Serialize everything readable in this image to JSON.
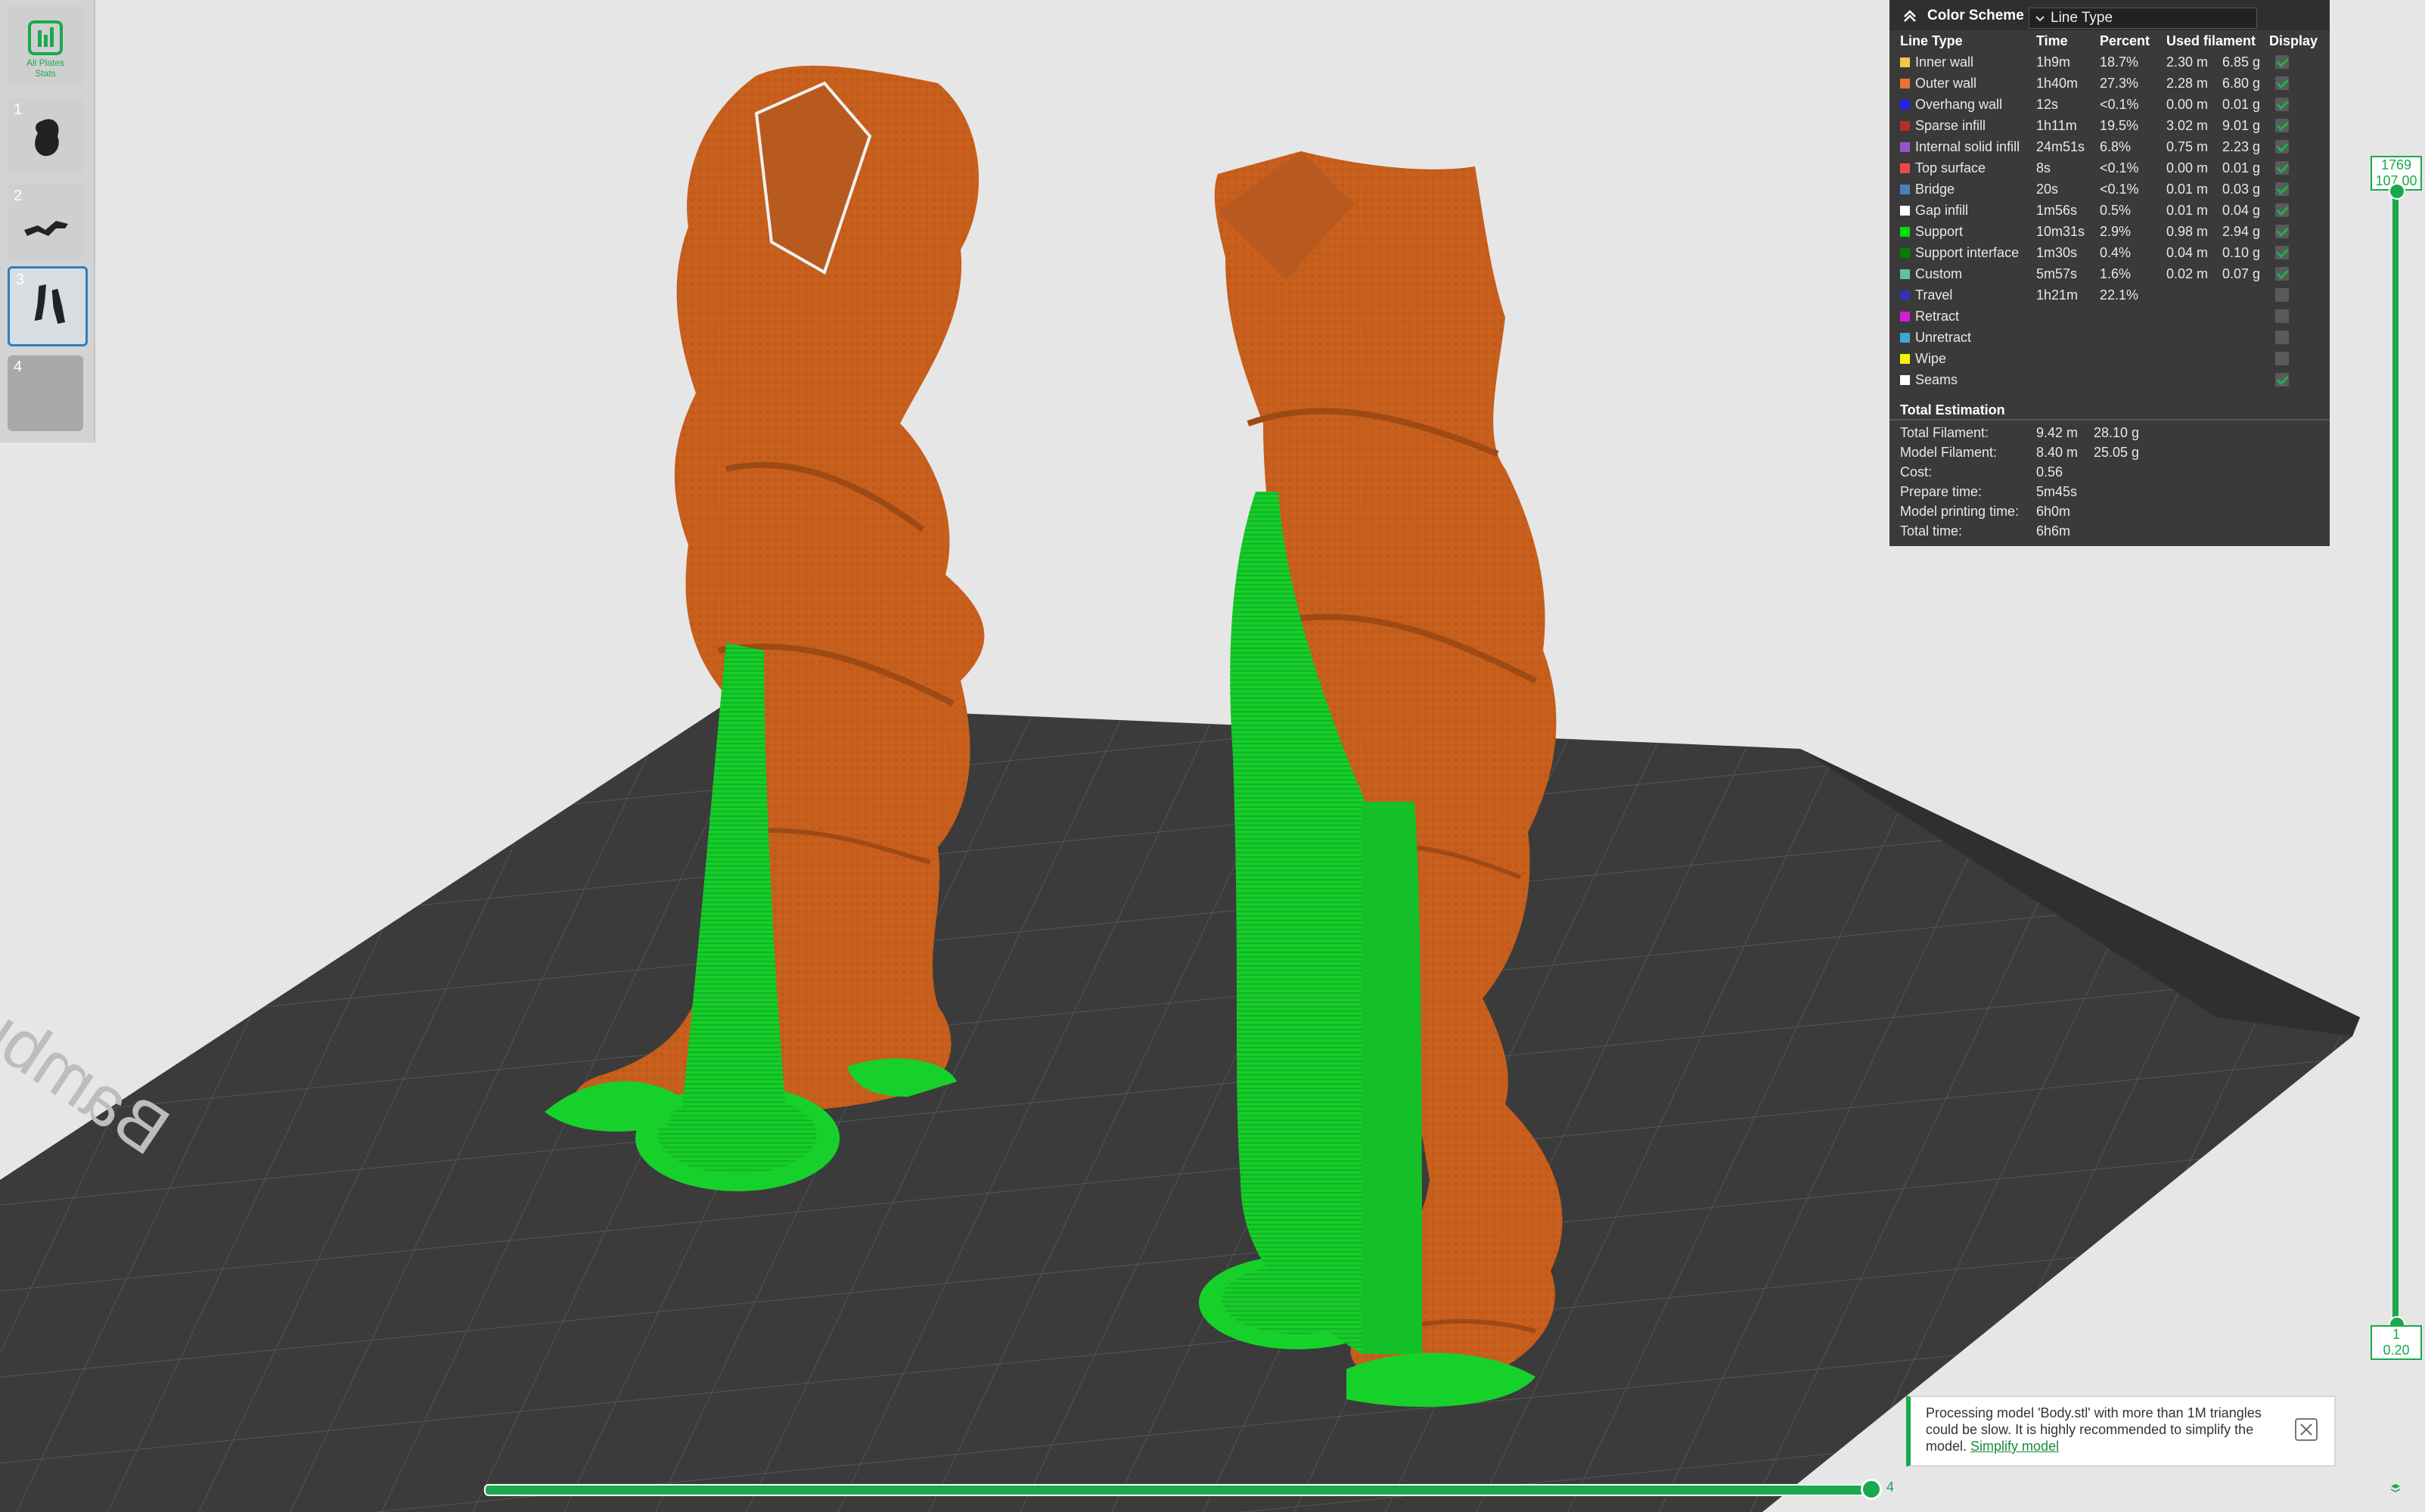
{
  "app": {
    "window": "3D slice preview"
  },
  "colors": {
    "accent": "#1aa94c",
    "model_orange": "#c8601c",
    "support_green": "#17d12b",
    "bed_dark": "#3b3b3b",
    "background": "#e6e6e6"
  },
  "plate_bar": {
    "stats_label_line1": "All Plates",
    "stats_label_line2": "Stats",
    "plates": [
      {
        "number": "1"
      },
      {
        "number": "2"
      },
      {
        "number": "3"
      },
      {
        "number": "4"
      }
    ],
    "selected_plate": "3"
  },
  "bed": {
    "label": "Bambu Textured PEI Plate"
  },
  "legend": {
    "title": "Color Scheme",
    "scheme_value": "Line Type",
    "columns": [
      "Line Type",
      "Time",
      "Percent",
      "Used filament",
      "Display"
    ],
    "rows": [
      {
        "name": "Inner wall",
        "color": "#f2c744",
        "time": "1h9m",
        "percent": "18.7%",
        "length": "2.30 m",
        "weight": "6.85 g",
        "display": true
      },
      {
        "name": "Outer wall",
        "color": "#e8742c",
        "time": "1h40m",
        "percent": "27.3%",
        "length": "2.28 m",
        "weight": "6.80 g",
        "display": true
      },
      {
        "name": "Overhang wall",
        "color": "#2222e6",
        "time": "12s",
        "percent": "<0.1%",
        "length": "0.00 m",
        "weight": "0.01 g",
        "display": true
      },
      {
        "name": "Sparse infill",
        "color": "#b03029",
        "time": "1h11m",
        "percent": "19.5%",
        "length": "3.02 m",
        "weight": "9.01 g",
        "display": true
      },
      {
        "name": "Internal solid infill",
        "color": "#9654cc",
        "time": "24m51s",
        "percent": "6.8%",
        "length": "0.75 m",
        "weight": "2.23 g",
        "display": true
      },
      {
        "name": "Top surface",
        "color": "#f04848",
        "time": "8s",
        "percent": "<0.1%",
        "length": "0.00 m",
        "weight": "0.01 g",
        "display": true
      },
      {
        "name": "Bridge",
        "color": "#4d80ba",
        "time": "20s",
        "percent": "<0.1%",
        "length": "0.01 m",
        "weight": "0.03 g",
        "display": true
      },
      {
        "name": "Gap infill",
        "color": "#ffffff",
        "time": "1m56s",
        "percent": "0.5%",
        "length": "0.01 m",
        "weight": "0.04 g",
        "display": true
      },
      {
        "name": "Support",
        "color": "#00e000",
        "time": "10m31s",
        "percent": "2.9%",
        "length": "0.98 m",
        "weight": "2.94 g",
        "display": true
      },
      {
        "name": "Support interface",
        "color": "#008000",
        "time": "1m30s",
        "percent": "0.4%",
        "length": "0.04 m",
        "weight": "0.10 g",
        "display": true
      },
      {
        "name": "Custom",
        "color": "#5ec3a0",
        "time": "5m57s",
        "percent": "1.6%",
        "length": "0.02 m",
        "weight": "0.07 g",
        "display": true
      },
      {
        "name": "Travel",
        "color": "#3333b0",
        "time": "1h21m",
        "percent": "22.1%",
        "length": "",
        "weight": "",
        "display": false
      },
      {
        "name": "Retract",
        "color": "#d21fd2",
        "time": "",
        "percent": "",
        "length": "",
        "weight": "",
        "display": false
      },
      {
        "name": "Unretract",
        "color": "#3aa7d6",
        "time": "",
        "percent": "",
        "length": "",
        "weight": "",
        "display": false
      },
      {
        "name": "Wipe",
        "color": "#f5f500",
        "time": "",
        "percent": "",
        "length": "",
        "weight": "",
        "display": false
      },
      {
        "name": "Seams",
        "color": "#ffffff",
        "time": "",
        "percent": "",
        "length": "",
        "weight": "",
        "display": true
      }
    ],
    "estimation_title": "Total Estimation",
    "estimation": [
      {
        "label": "Total Filament:",
        "value": "9.42 m",
        "value2": "28.10 g"
      },
      {
        "label": "Model Filament:",
        "value": "8.40 m",
        "value2": "25.05 g"
      },
      {
        "label": "Cost:",
        "value": "0.56",
        "value2": ""
      },
      {
        "label": "Prepare time:",
        "value": "5m45s",
        "value2": ""
      },
      {
        "label": "Model printing time:",
        "value": "6h0m",
        "value2": ""
      },
      {
        "label": "Total time:",
        "value": "6h6m",
        "value2": ""
      }
    ]
  },
  "layer_slider": {
    "top_layer": "1769",
    "top_height": "107.00",
    "bottom_layer": "1",
    "bottom_height": "0.20"
  },
  "move_slider": {
    "value": "4"
  },
  "notification": {
    "message": "Processing model 'Body.stl' with more than 1M triangles could be slow. It is highly recommended to simplify the model.",
    "link": "Simplify model"
  }
}
